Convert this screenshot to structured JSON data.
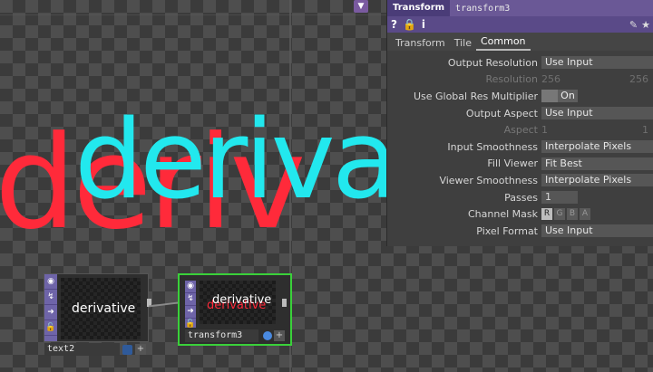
{
  "viewer": {
    "text_red": "deriv",
    "text_cyan": "deriva"
  },
  "panel": {
    "op_type": "Transform",
    "op_name": "transform3",
    "icons": [
      "help-icon",
      "python-help-icon",
      "info-icon"
    ],
    "tabs": [
      "Transform",
      "Tile",
      "Common"
    ],
    "active_tab": "Common",
    "params": {
      "output_resolution": {
        "label": "Output Resolution",
        "value": "Use Input"
      },
      "resolution": {
        "label": "Resolution",
        "w": "256",
        "h": "256"
      },
      "global_res": {
        "label": "Use Global Res Multiplier",
        "value": "On"
      },
      "output_aspect": {
        "label": "Output Aspect",
        "value": "Use Input"
      },
      "aspect": {
        "label": "Aspect",
        "a": "1",
        "b": "1"
      },
      "input_smoothness": {
        "label": "Input Smoothness",
        "value": "Interpolate Pixels"
      },
      "fill_viewer": {
        "label": "Fill Viewer",
        "value": "Fit Best"
      },
      "viewer_smoothness": {
        "label": "Viewer Smoothness",
        "value": "Interpolate Pixels"
      },
      "passes": {
        "label": "Passes",
        "value": "1"
      },
      "channel_mask": {
        "label": "Channel Mask",
        "channels": [
          "R",
          "G",
          "B",
          "A"
        ]
      },
      "pixel_format": {
        "label": "Pixel Format",
        "value": "Use Input"
      }
    }
  },
  "nodes": {
    "text2": {
      "label": "text2",
      "preview_text": "derivative"
    },
    "transform3": {
      "label": "transform3",
      "preview_text": "derivative"
    }
  },
  "colors": {
    "selected_border": "#3ad13a",
    "red": "#ff2a3a",
    "cyan": "#22e8ee",
    "panel_header": "#6a5896"
  }
}
